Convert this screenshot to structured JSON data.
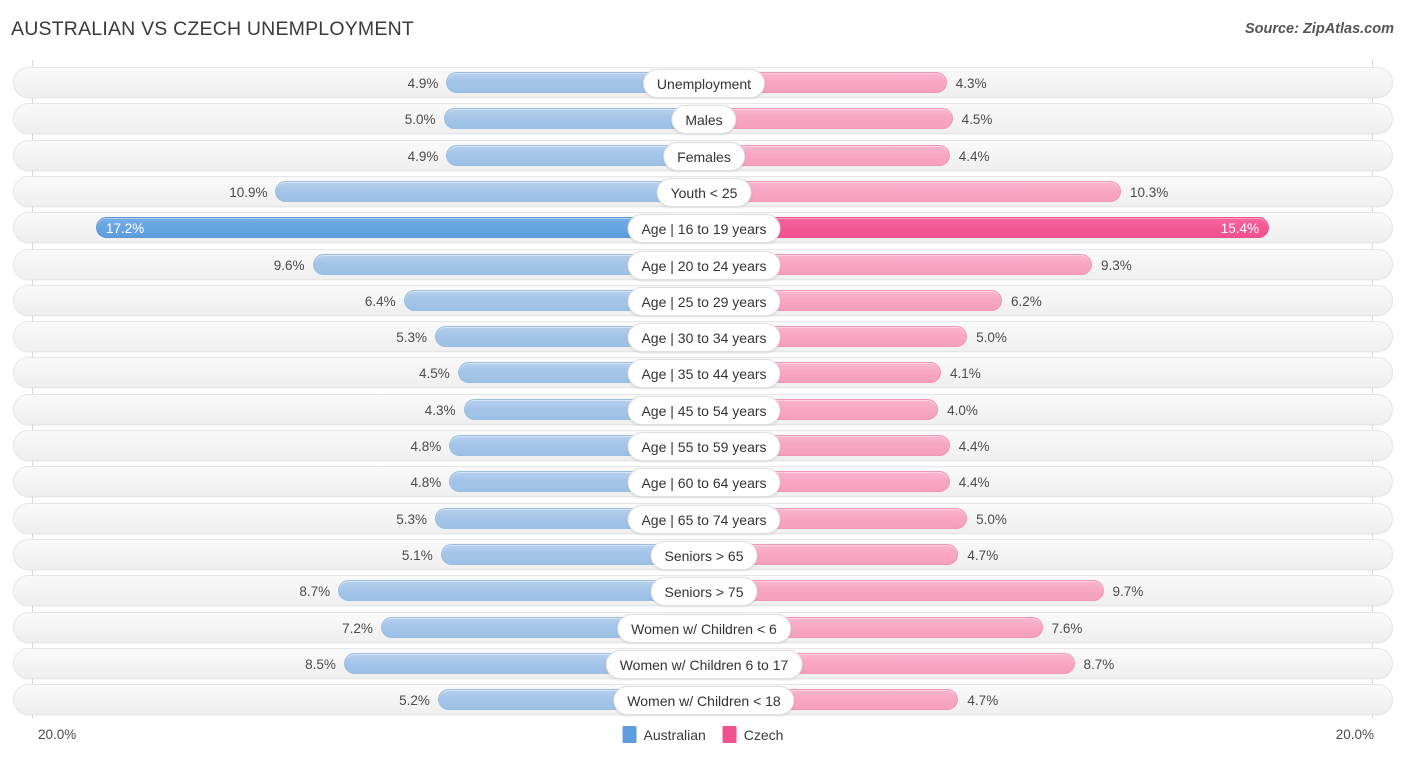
{
  "header": {
    "title": "AUSTRALIAN VS CZECH UNEMPLOYMENT",
    "source": "Source: ZipAtlas.com"
  },
  "footer": {
    "axis_left": "20.0%",
    "axis_right": "20.0%",
    "legend": [
      {
        "label": "Australian",
        "color": "#5f9edd"
      },
      {
        "label": "Czech",
        "color": "#f15190"
      }
    ]
  },
  "chart_data": {
    "type": "bar",
    "title": "AUSTRALIAN VS CZECH UNEMPLOYMENT",
    "subtitle": "Source: ZipAtlas.com",
    "orientation": "horizontal-diverging",
    "xlabel": "",
    "ylabel": "",
    "xlim": [
      20.0,
      20.0
    ],
    "axis_left_max": "20.0%",
    "axis_right_max": "20.0%",
    "grid": true,
    "legend_position": "bottom-center",
    "categories": [
      "Unemployment",
      "Males",
      "Females",
      "Youth < 25",
      "Age | 16 to 19 years",
      "Age | 20 to 24 years",
      "Age | 25 to 29 years",
      "Age | 30 to 34 years",
      "Age | 35 to 44 years",
      "Age | 45 to 54 years",
      "Age | 55 to 59 years",
      "Age | 60 to 64 years",
      "Age | 65 to 74 years",
      "Seniors > 65",
      "Seniors > 75",
      "Women w/ Children < 6",
      "Women w/ Children 6 to 17",
      "Women w/ Children < 18"
    ],
    "series": [
      {
        "name": "Australian",
        "color": "#a6c6e9",
        "color_max": "#5f9edd",
        "values": [
          4.9,
          5.0,
          4.9,
          10.9,
          17.2,
          9.6,
          6.4,
          5.3,
          4.5,
          4.3,
          4.8,
          4.8,
          5.3,
          5.1,
          8.7,
          7.2,
          8.5,
          5.2
        ],
        "labels": [
          "4.9%",
          "5.0%",
          "4.9%",
          "10.9%",
          "17.2%",
          "9.6%",
          "6.4%",
          "5.3%",
          "4.5%",
          "4.3%",
          "4.8%",
          "4.8%",
          "5.3%",
          "5.1%",
          "8.7%",
          "7.2%",
          "8.5%",
          "5.2%"
        ]
      },
      {
        "name": "Czech",
        "color": "#f8a8c4",
        "color_max": "#f15190",
        "values": [
          4.3,
          4.5,
          4.4,
          10.3,
          15.4,
          9.3,
          6.2,
          5.0,
          4.1,
          4.0,
          4.4,
          4.4,
          5.0,
          4.7,
          9.7,
          7.6,
          8.7,
          4.7
        ],
        "labels": [
          "4.3%",
          "4.5%",
          "4.4%",
          "10.3%",
          "15.4%",
          "9.3%",
          "6.2%",
          "5.0%",
          "4.1%",
          "4.0%",
          "4.4%",
          "4.4%",
          "5.0%",
          "4.7%",
          "9.7%",
          "7.6%",
          "8.7%",
          "4.7%"
        ]
      }
    ],
    "max_row_index": 4
  }
}
